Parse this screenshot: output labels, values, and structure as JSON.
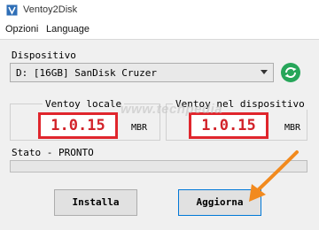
{
  "window": {
    "title": "Ventoy2Disk"
  },
  "menu": {
    "items": [
      "Opzioni",
      "Language"
    ]
  },
  "device": {
    "label": "Dispositivo",
    "selected": "D: [16GB] SanDisk Cruzer"
  },
  "local": {
    "label": "Ventoy locale",
    "version": "1.0.15",
    "partition_style": "MBR"
  },
  "on_device": {
    "label": "Ventoy nel dispositivo",
    "version": "1.0.15",
    "partition_style": "MBR"
  },
  "watermark": "www.techpedia",
  "status": {
    "label": "Stato - PRONTO",
    "progress": 0
  },
  "buttons": {
    "install": "Installa",
    "update": "Aggiorna"
  },
  "colors": {
    "refresh": "#27a65a",
    "highlight": "#e0262d",
    "arrow": "#f28a1e"
  }
}
